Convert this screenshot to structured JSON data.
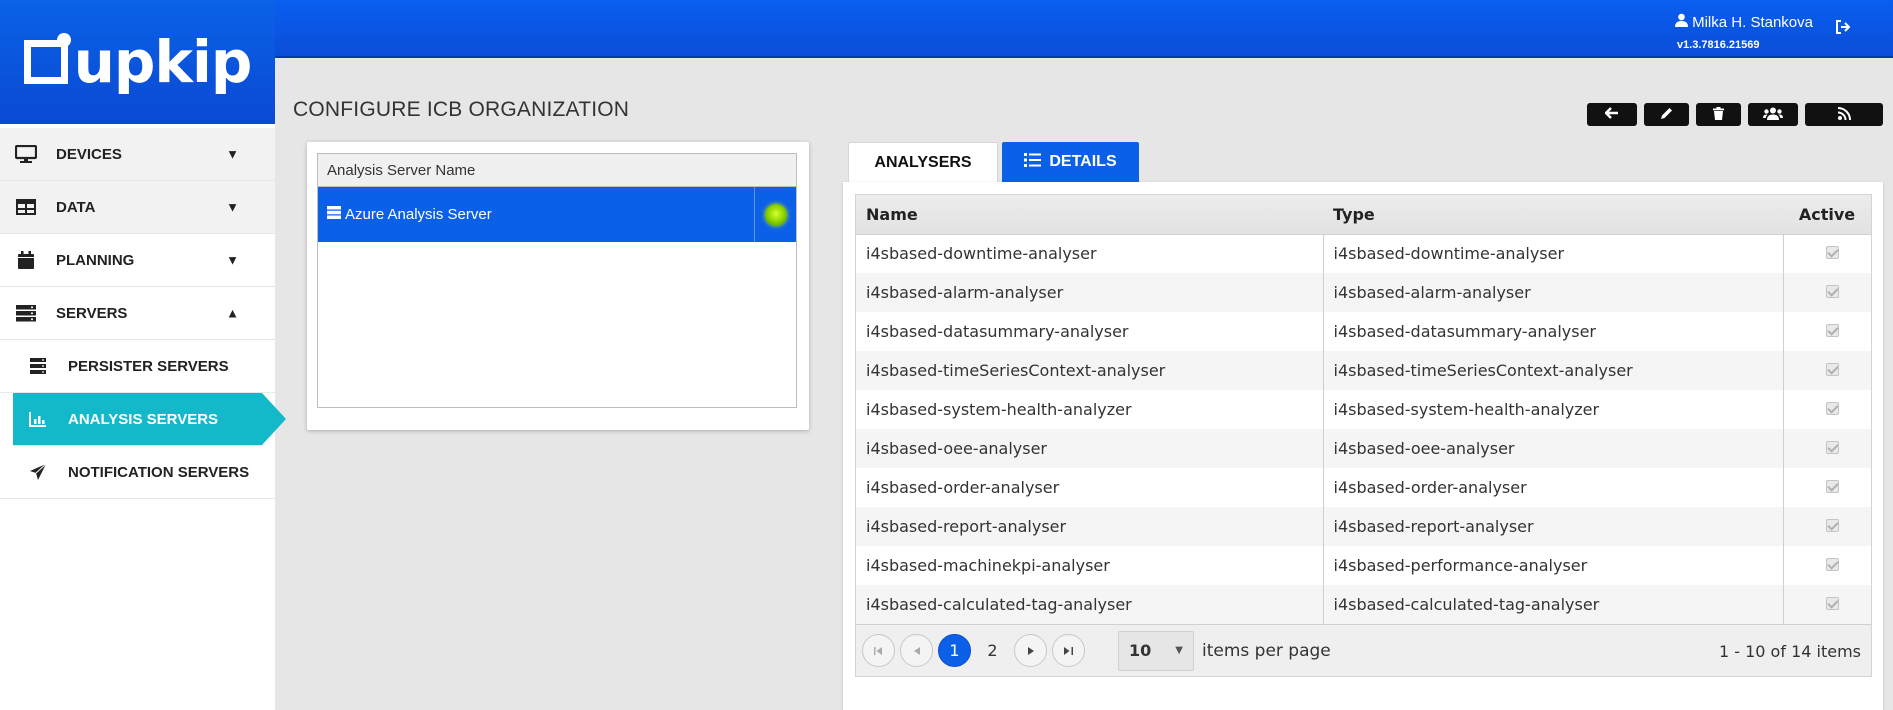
{
  "brand": {
    "name": "upkip"
  },
  "header": {
    "user_name": "Milka H. Stankova",
    "version": "v1.3.7816.21569"
  },
  "sidebar": {
    "collapse_glyph": "«",
    "items": [
      {
        "label": "DEVICES",
        "icon": "monitor-icon"
      },
      {
        "label": "DATA",
        "icon": "table-icon"
      },
      {
        "label": "PLANNING",
        "icon": "calendar-icon"
      },
      {
        "label": "SERVERS",
        "icon": "server-icon"
      }
    ],
    "sub_items": [
      {
        "label": "PERSISTER SERVERS",
        "icon": "server-icon"
      },
      {
        "label": "ANALYSIS SERVERS",
        "icon": "bar-chart-icon"
      },
      {
        "label": "NOTIFICATION SERVERS",
        "icon": "paper-plane-icon"
      }
    ]
  },
  "page": {
    "title": "CONFIGURE ICB ORGANIZATION"
  },
  "toolbar": {
    "buttons": [
      "back-arrow-icon",
      "pencil-icon",
      "trash-icon",
      "users-icon",
      "rss-icon"
    ]
  },
  "servers_grid": {
    "header": "Analysis Server Name",
    "rows": [
      {
        "name": "Azure Analysis Server",
        "status": "online"
      }
    ]
  },
  "tabs": {
    "analysers": "ANALYSERS",
    "details": "DETAILS"
  },
  "analysers_grid": {
    "columns": {
      "name": "Name",
      "type": "Type",
      "active": "Active"
    },
    "rows": [
      {
        "name": "i4sbased-downtime-analyser",
        "type": "i4sbased-downtime-analyser"
      },
      {
        "name": "i4sbased-alarm-analyser",
        "type": "i4sbased-alarm-analyser"
      },
      {
        "name": "i4sbased-datasummary-analyser",
        "type": "i4sbased-datasummary-analyser"
      },
      {
        "name": "i4sbased-timeSeriesContext-analyser",
        "type": "i4sbased-timeSeriesContext-analyser"
      },
      {
        "name": "i4sbased-system-health-analyzer",
        "type": "i4sbased-system-health-analyzer"
      },
      {
        "name": "i4sbased-oee-analyser",
        "type": "i4sbased-oee-analyser"
      },
      {
        "name": "i4sbased-order-analyser",
        "type": "i4sbased-order-analyser"
      },
      {
        "name": "i4sbased-report-analyser",
        "type": "i4sbased-report-analyser"
      },
      {
        "name": "i4sbased-machinekpi-analyser",
        "type": "i4sbased-performance-analyser"
      },
      {
        "name": "i4sbased-calculated-tag-analyser",
        "type": "i4sbased-calculated-tag-analyser"
      }
    ]
  },
  "pager": {
    "current_page": "1",
    "next_page": "2",
    "page_size": "10",
    "items_per_page_label": "items per page",
    "info": "1 - 10 of 14 items"
  },
  "colors": {
    "brand_blue": "#0c60e8",
    "active_teal": "#14b9c9",
    "status_green": "#93d800"
  }
}
